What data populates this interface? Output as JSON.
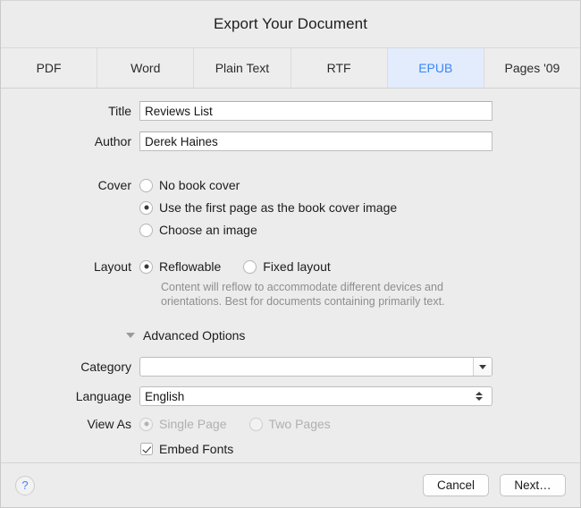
{
  "window": {
    "title": "Export Your Document"
  },
  "tabs": [
    {
      "label": "PDF",
      "selected": false
    },
    {
      "label": "Word",
      "selected": false
    },
    {
      "label": "Plain Text",
      "selected": false
    },
    {
      "label": "RTF",
      "selected": false
    },
    {
      "label": "EPUB",
      "selected": true
    },
    {
      "label": "Pages '09",
      "selected": false
    }
  ],
  "form": {
    "title_field": {
      "label": "Title",
      "value": "Reviews List",
      "placeholder": ""
    },
    "author_field": {
      "label": "Author",
      "value": "Derek Haines",
      "placeholder": ""
    },
    "cover": {
      "label": "Cover",
      "options": [
        {
          "label": "No book cover",
          "selected": false
        },
        {
          "label": "Use the first page as the book cover image",
          "selected": true
        },
        {
          "label": "Choose an image",
          "selected": false
        }
      ]
    },
    "layout": {
      "label": "Layout",
      "options": [
        {
          "label": "Reflowable",
          "selected": true
        },
        {
          "label": "Fixed layout",
          "selected": false
        }
      ],
      "help_text": "Content will reflow to accommodate different devices and orientations. Best for documents containing primarily text."
    },
    "advanced_options": {
      "label": "Advanced Options",
      "expanded": true,
      "disclosure_icon": "triangle-down-icon"
    },
    "category": {
      "label": "Category",
      "value": "",
      "icon": "chevron-down-icon"
    },
    "language": {
      "label": "Language",
      "value": "English",
      "icon": "updown-chevron-icon"
    },
    "view_as": {
      "label": "View As",
      "disabled": true,
      "options": [
        {
          "label": "Single Page",
          "selected": true
        },
        {
          "label": "Two Pages",
          "selected": false
        }
      ]
    },
    "embed_fonts": {
      "label": "Embed Fonts",
      "checked": true
    }
  },
  "footer": {
    "help_label": "?",
    "cancel_label": "Cancel",
    "next_label": "Next…"
  },
  "colors": {
    "accent_blue": "#3a86f7",
    "selected_tab_bg": "#e3ecfd",
    "window_bg": "#ececec",
    "help_text": "#8e8e8e"
  }
}
